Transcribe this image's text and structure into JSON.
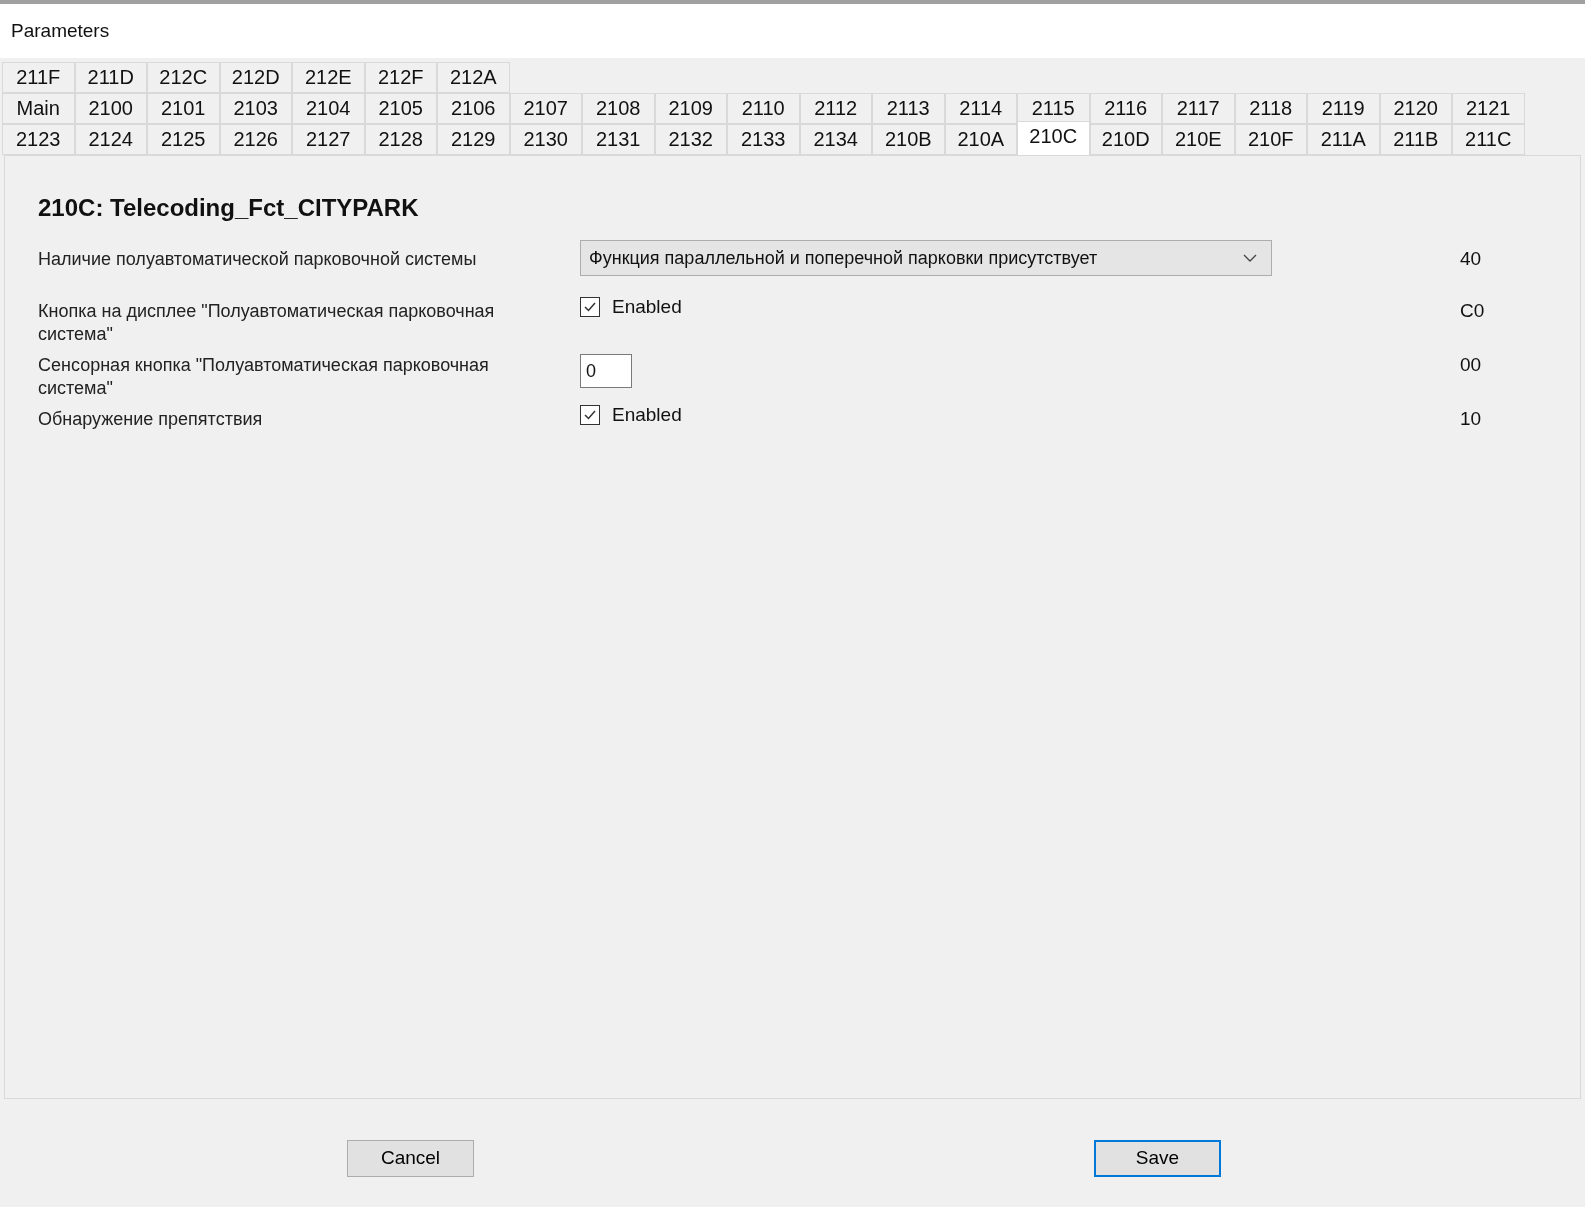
{
  "window": {
    "title": "Parameters"
  },
  "tab_rows": [
    [
      {
        "label": "211F",
        "selected": false
      },
      {
        "label": "211D",
        "selected": false
      },
      {
        "label": "212C",
        "selected": false
      },
      {
        "label": "212D",
        "selected": false
      },
      {
        "label": "212E",
        "selected": false
      },
      {
        "label": "212F",
        "selected": false
      },
      {
        "label": "212A",
        "selected": false
      }
    ],
    [
      {
        "label": "Main",
        "selected": false
      },
      {
        "label": "2100",
        "selected": false
      },
      {
        "label": "2101",
        "selected": false
      },
      {
        "label": "2103",
        "selected": false
      },
      {
        "label": "2104",
        "selected": false
      },
      {
        "label": "2105",
        "selected": false
      },
      {
        "label": "2106",
        "selected": false
      },
      {
        "label": "2107",
        "selected": false
      },
      {
        "label": "2108",
        "selected": false
      },
      {
        "label": "2109",
        "selected": false
      },
      {
        "label": "2110",
        "selected": false
      },
      {
        "label": "2112",
        "selected": false
      },
      {
        "label": "2113",
        "selected": false
      },
      {
        "label": "2114",
        "selected": false
      },
      {
        "label": "2115",
        "selected": false
      },
      {
        "label": "2116",
        "selected": false
      },
      {
        "label": "2117",
        "selected": false
      },
      {
        "label": "2118",
        "selected": false
      },
      {
        "label": "2119",
        "selected": false
      },
      {
        "label": "2120",
        "selected": false
      },
      {
        "label": "2121",
        "selected": false
      }
    ],
    [
      {
        "label": "2123",
        "selected": false
      },
      {
        "label": "2124",
        "selected": false
      },
      {
        "label": "2125",
        "selected": false
      },
      {
        "label": "2126",
        "selected": false
      },
      {
        "label": "2127",
        "selected": false
      },
      {
        "label": "2128",
        "selected": false
      },
      {
        "label": "2129",
        "selected": false
      },
      {
        "label": "2130",
        "selected": false
      },
      {
        "label": "2131",
        "selected": false
      },
      {
        "label": "2132",
        "selected": false
      },
      {
        "label": "2133",
        "selected": false
      },
      {
        "label": "2134",
        "selected": false
      },
      {
        "label": "210B",
        "selected": false
      },
      {
        "label": "210A",
        "selected": false
      },
      {
        "label": "210C",
        "selected": true
      },
      {
        "label": "210D",
        "selected": false
      },
      {
        "label": "210E",
        "selected": false
      },
      {
        "label": "210F",
        "selected": false
      },
      {
        "label": "211A",
        "selected": false
      },
      {
        "label": "211B",
        "selected": false
      },
      {
        "label": "211C",
        "selected": false
      }
    ]
  ],
  "section_title": "210C: Telecoding_Fct_CITYPARK",
  "parameters": [
    {
      "kind": "dropdown",
      "label": "Наличие полуавтоматической парковочной системы",
      "value": "Функция параллельной и поперечной парковки присутствует",
      "code": "40"
    },
    {
      "kind": "checkbox",
      "label": "Кнопка на дисплее \"Полуавтоматическая парковочная система\"",
      "checkbox_label": "Enabled",
      "checked": true,
      "code": "C0"
    },
    {
      "kind": "number",
      "label": "Сенсорная кнопка \"Полуавтоматическая парковочная система\"",
      "value": "0",
      "code": "00"
    },
    {
      "kind": "checkbox",
      "label": "Обнаружение препятствия",
      "checkbox_label": "Enabled",
      "checked": true,
      "code": "10"
    }
  ],
  "buttons": {
    "cancel": "Cancel",
    "save": "Save"
  }
}
